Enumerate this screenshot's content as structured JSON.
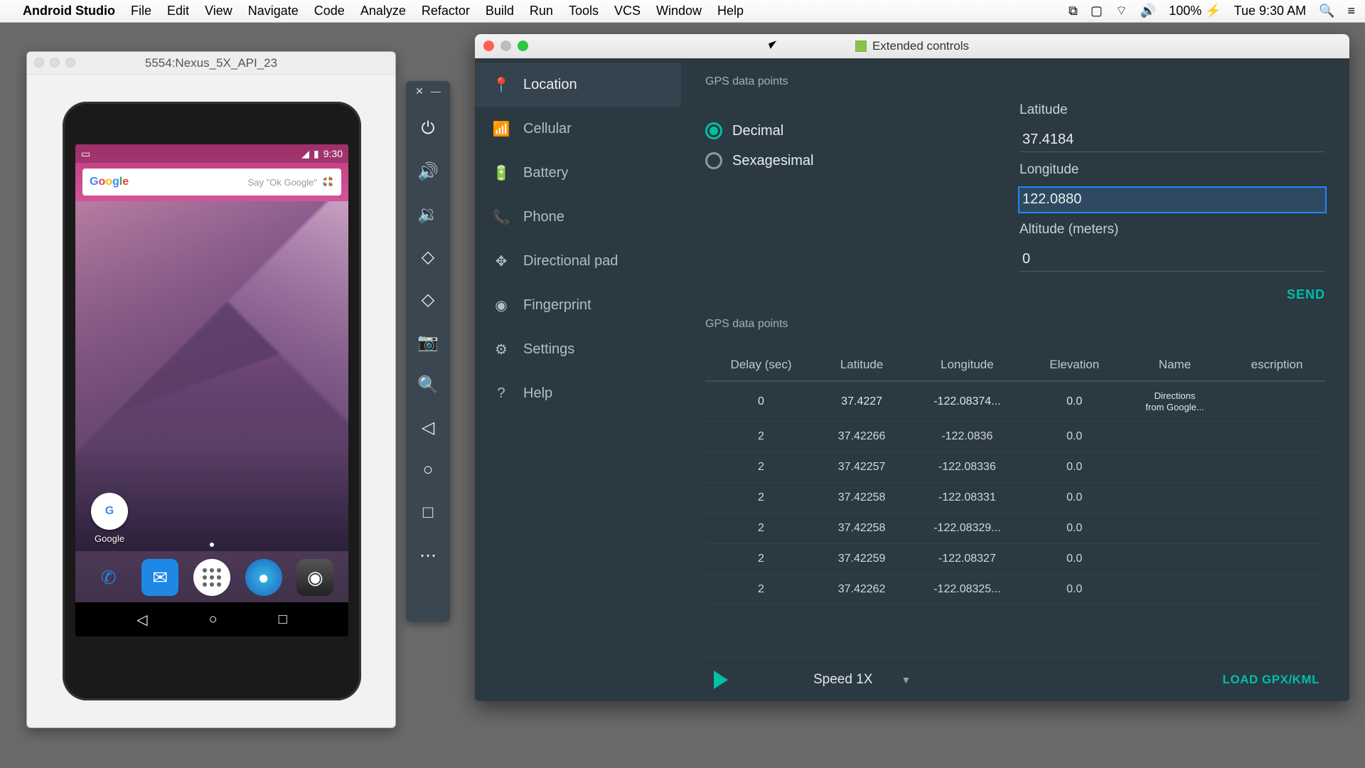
{
  "menubar": {
    "app": "Android Studio",
    "items": [
      "File",
      "Edit",
      "View",
      "Navigate",
      "Code",
      "Analyze",
      "Refactor",
      "Build",
      "Run",
      "Tools",
      "VCS",
      "Window",
      "Help"
    ],
    "battery": "100%",
    "clock": "Tue 9:30 AM"
  },
  "emulator": {
    "title": "5554:Nexus_5X_API_23",
    "status_time": "9:30",
    "search_placeholder": "Say \"Ok Google\"",
    "google_label": "Google"
  },
  "toolbar_icons": [
    "power",
    "volume-up",
    "volume-down",
    "rotate-left",
    "rotate-right",
    "camera",
    "zoom",
    "back",
    "home",
    "overview",
    "more"
  ],
  "extended": {
    "title": "Extended controls",
    "sidebar": [
      {
        "icon": "location-icon",
        "label": "Location",
        "active": true
      },
      {
        "icon": "cellular-icon",
        "label": "Cellular",
        "active": false
      },
      {
        "icon": "battery-icon",
        "label": "Battery",
        "active": false
      },
      {
        "icon": "phone-icon",
        "label": "Phone",
        "active": false
      },
      {
        "icon": "dpad-icon",
        "label": "Directional pad",
        "active": false
      },
      {
        "icon": "fingerprint-icon",
        "label": "Fingerprint",
        "active": false
      },
      {
        "icon": "settings-icon",
        "label": "Settings",
        "active": false
      },
      {
        "icon": "help-icon",
        "label": "Help",
        "active": false
      }
    ],
    "section1_title": "GPS data points",
    "coord_mode": {
      "decimal": "Decimal",
      "sexagesimal": "Sexagesimal",
      "selected": "decimal"
    },
    "latitude_label": "Latitude",
    "latitude_value": "37.4184",
    "longitude_label": "Longitude",
    "longitude_value": "122.0880",
    "altitude_label": "Altitude (meters)",
    "altitude_value": "0",
    "send_label": "SEND",
    "section2_title": "GPS data points",
    "columns": [
      "Delay (sec)",
      "Latitude",
      "Longitude",
      "Elevation",
      "Name",
      "escription"
    ],
    "rows": [
      {
        "delay": "0",
        "lat": "37.4227",
        "lon": "-122.08374...",
        "elev": "0.0",
        "name": "Directions from Google...",
        "desc": ""
      },
      {
        "delay": "2",
        "lat": "37.42266",
        "lon": "-122.0836",
        "elev": "0.0",
        "name": "",
        "desc": ""
      },
      {
        "delay": "2",
        "lat": "37.42257",
        "lon": "-122.08336",
        "elev": "0.0",
        "name": "",
        "desc": ""
      },
      {
        "delay": "2",
        "lat": "37.42258",
        "lon": "-122.08331",
        "elev": "0.0",
        "name": "",
        "desc": ""
      },
      {
        "delay": "2",
        "lat": "37.42258",
        "lon": "-122.08329...",
        "elev": "0.0",
        "name": "",
        "desc": ""
      },
      {
        "delay": "2",
        "lat": "37.42259",
        "lon": "-122.08327",
        "elev": "0.0",
        "name": "",
        "desc": ""
      },
      {
        "delay": "2",
        "lat": "37.42262",
        "lon": "-122.08325...",
        "elev": "0.0",
        "name": "",
        "desc": ""
      }
    ],
    "speed_label": "Speed 1X",
    "load_label": "LOAD GPX/KML"
  }
}
